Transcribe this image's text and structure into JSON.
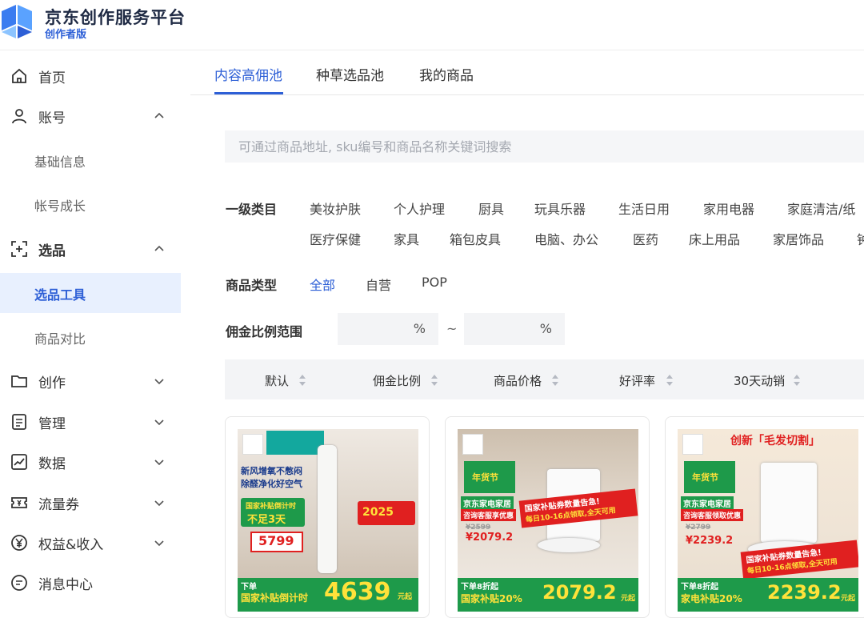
{
  "brand": {
    "title": "京东创作服务平台",
    "subtitle": "创作者版"
  },
  "sidebar": {
    "home": {
      "label": "首页",
      "icon": "home-icon"
    },
    "account": {
      "label": "账号",
      "icon": "user-icon",
      "expanded": true,
      "items": [
        {
          "label": "基础信息"
        },
        {
          "label": "帐号成长"
        }
      ]
    },
    "selection": {
      "label": "选品",
      "icon": "crosshair-plus-icon",
      "expanded": true,
      "items": [
        {
          "label": "选品工具",
          "active": true
        },
        {
          "label": "商品对比"
        }
      ]
    },
    "creation": {
      "label": "创作",
      "icon": "folder-icon"
    },
    "manage": {
      "label": "管理",
      "icon": "list-icon"
    },
    "data": {
      "label": "数据",
      "icon": "chart-icon"
    },
    "traffic": {
      "label": "流量券",
      "icon": "ticket-icon"
    },
    "income": {
      "label": "权益&收入",
      "icon": "yen-icon"
    },
    "messages": {
      "label": "消息中心",
      "icon": "message-icon"
    }
  },
  "tabs": [
    {
      "label": "内容高佣池",
      "active": true
    },
    {
      "label": "种草选品池"
    },
    {
      "label": "我的商品"
    }
  ],
  "search": {
    "placeholder": "可通过商品地址, sku编号和商品名称关键词搜索"
  },
  "category": {
    "label": "一级类目",
    "row1": [
      "美妆护肤",
      "个人护理",
      "厨具",
      "玩具乐器",
      "生活日用",
      "家用电器",
      "家庭清洁/纸"
    ],
    "row2": [
      "医疗保健",
      "家具",
      "箱包皮具",
      "电脑、办公",
      "医药",
      "床上用品",
      "家居饰品",
      "钟"
    ]
  },
  "product_type": {
    "label": "商品类型",
    "options": [
      {
        "label": "全部",
        "active": true
      },
      {
        "label": "自营"
      },
      {
        "label": "POP"
      }
    ]
  },
  "commission": {
    "label": "佣金比例范围",
    "unit": "%",
    "separator": "~"
  },
  "sort": [
    {
      "label": "默认"
    },
    {
      "label": "佣金比例"
    },
    {
      "label": "商品价格"
    },
    {
      "label": "好评率"
    },
    {
      "label": "30天动销"
    }
  ],
  "products": [
    {
      "kind": "air-purifier",
      "headline": "新风增氧不憋闷",
      "headline2": "除醛净化好空气",
      "banner": "国家补贴倒计时",
      "countdown": "不足3天",
      "old_price": "5799",
      "promo": "2025",
      "bottom_prefix": "下单",
      "bottom_label": "国家补贴倒计时",
      "price": "4639",
      "price_suffix": "元起"
    },
    {
      "kind": "robot-vacuum",
      "festival": "年货节",
      "store": "京东家电家居",
      "tag": "咨询客服享优惠",
      "old_price": "¥2599",
      "mid_price": "¥2079.2",
      "promo": "国家补贴券数量告急!",
      "promo2": "每日10-16点领取,全天可用",
      "bottom_prefix": "下单8折起",
      "bottom_label": "国家补贴20%",
      "price": "2079.2",
      "price_suffix": "元起"
    },
    {
      "kind": "robot-vacuum-2",
      "top_banner": "创新「毛发切割」",
      "festival": "年货节",
      "store": "京东家电家居",
      "tag": "咨询客服领取优惠",
      "old_price": "¥2799",
      "mid_price": "¥2239.2",
      "promo": "国家补贴券数量告急!",
      "promo2": "每日10-16点领取,全天可用",
      "bottom_prefix": "下单8折起",
      "bottom_label": "家电补贴20%",
      "price": "2239.2",
      "price_suffix": "元起"
    }
  ],
  "colors": {
    "accent": "#2d5fd6",
    "active_bg": "#e8f0fe",
    "promo_green": "#1e9a4a",
    "promo_red": "#e02020",
    "price_yellow": "#ffe23a"
  }
}
